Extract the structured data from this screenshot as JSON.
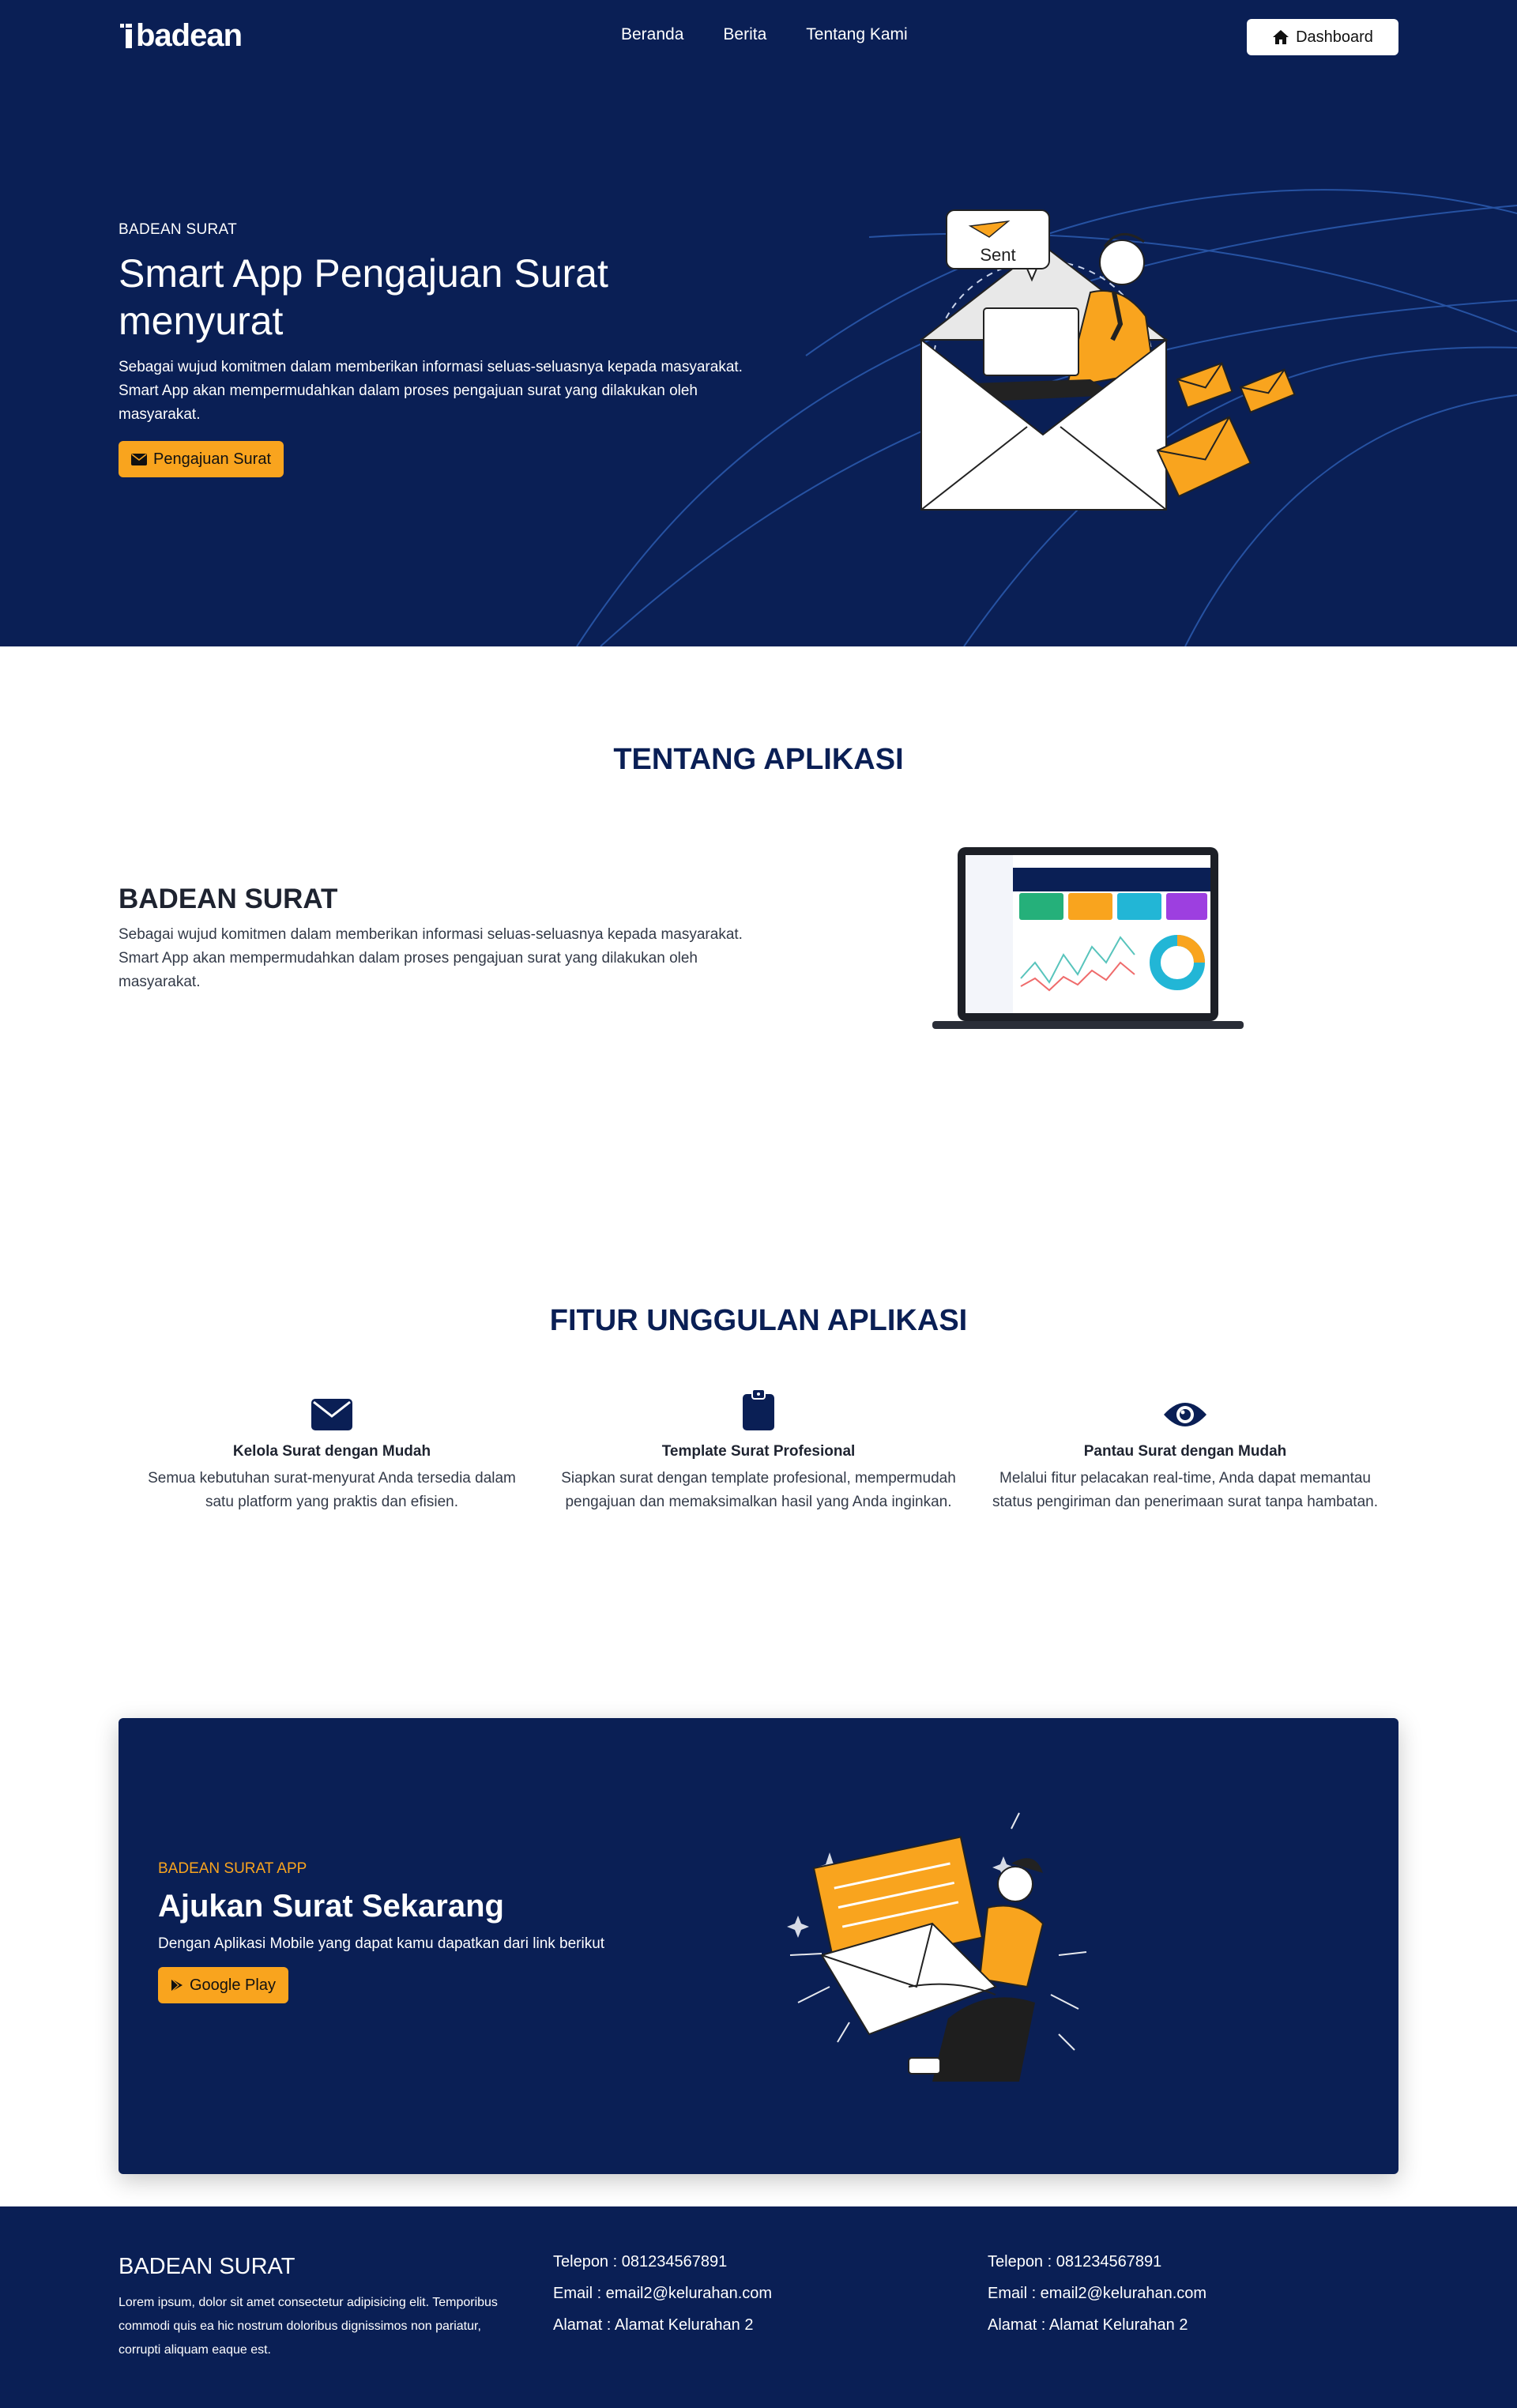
{
  "navbar": {
    "logo_text": "badean",
    "links": [
      "Beranda",
      "Berita",
      "Tentang Kami"
    ],
    "dashboard_label": "Dashboard"
  },
  "hero": {
    "kicker": "BADEAN SURAT",
    "title": "Smart App Pengajuan Surat menyurat",
    "description": "Sebagai wujud komitmen dalam memberikan informasi seluas-seluasnya kepada masyarakat. Smart App akan mempermudahkan dalam proses pengajuan surat yang dilakukan oleh masyarakat.",
    "button_label": "Pengajuan Surat",
    "bubble_text": "Sent"
  },
  "about": {
    "section_title": "TENTANG APLIKASI",
    "heading": "BADEAN SURAT",
    "description": "Sebagai wujud komitmen dalam memberikan informasi seluas-seluasnya kepada masyarakat. Smart App akan mempermudahkan dalam proses pengajuan surat yang dilakukan oleh masyarakat."
  },
  "features": {
    "section_title": "FITUR UNGGULAN APLIKASI",
    "items": [
      {
        "icon": "envelope-icon",
        "title": "Kelola Surat dengan Mudah",
        "desc": "Semua kebutuhan surat-menyurat Anda tersedia dalam satu platform yang praktis dan efisien."
      },
      {
        "icon": "clipboard-icon",
        "title": "Template Surat Profesional",
        "desc": "Siapkan surat dengan template profesional, mempermudah pengajuan dan memaksimalkan hasil yang Anda inginkan."
      },
      {
        "icon": "eye-icon",
        "title": "Pantau Surat dengan Mudah",
        "desc": "Melalui fitur pelacakan real-time, Anda dapat memantau status pengiriman dan penerimaan surat tanpa hambatan."
      }
    ]
  },
  "cta": {
    "kicker": "BADEAN SURAT APP",
    "title": "Ajukan Surat Sekarang",
    "description": "Dengan Aplikasi Mobile yang dapat kamu dapatkan dari link berikut",
    "button_label": "Google Play"
  },
  "footer": {
    "brand": "BADEAN SURAT",
    "description": "Lorem ipsum, dolor sit amet consectetur adipisicing elit. Temporibus commodi quis ea hic nostrum doloribus dignissimos non pariatur, corrupti aliquam eaque est.",
    "col1": [
      "Telepon : 081234567891",
      "Email : email2@kelurahan.com",
      "Alamat : Alamat Kelurahan 2"
    ],
    "col2": [
      "Telepon : 081234567891",
      "Email : email2@kelurahan.com",
      "Alamat : Alamat Kelurahan 2"
    ]
  },
  "colors": {
    "navy": "#0a1f55",
    "orange": "#f9a41e",
    "white": "#ffffff"
  }
}
